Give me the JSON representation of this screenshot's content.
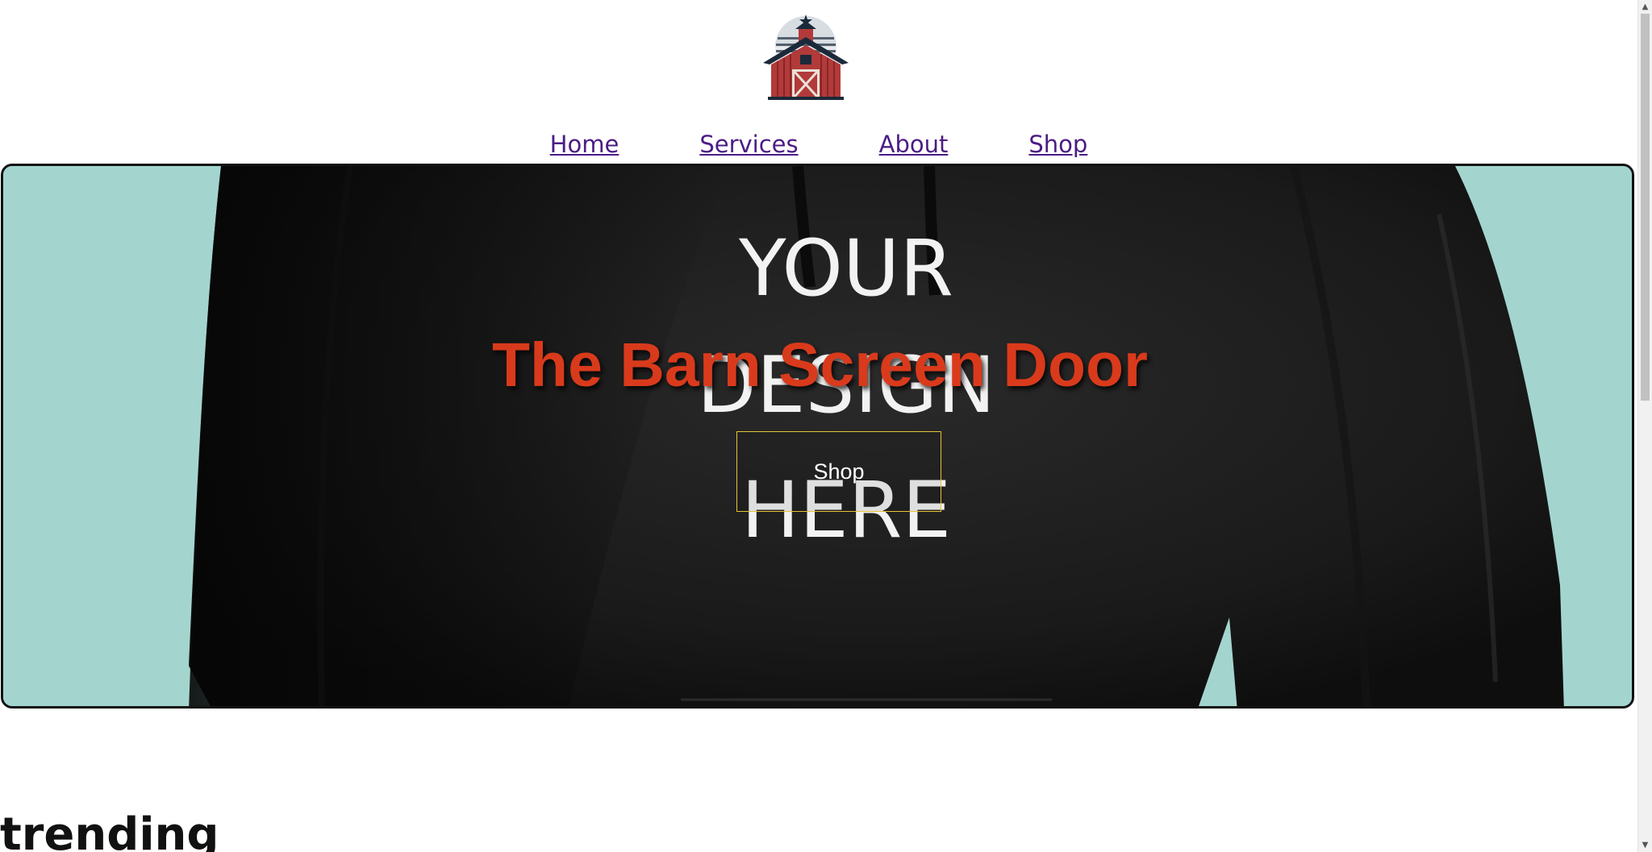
{
  "nav": {
    "items": [
      {
        "label": "Home"
      },
      {
        "label": "Services"
      },
      {
        "label": "About"
      },
      {
        "label": "Shop"
      }
    ]
  },
  "hero": {
    "title": "The Barn Screen Door",
    "shop_button": "Shop",
    "background_print": [
      "YOUR",
      "DESIGN",
      "HERE"
    ]
  },
  "sections": {
    "trending_heading": "trending"
  },
  "icons": {
    "logo": "barn-logo-icon",
    "scroll_up": "chevron-up-icon",
    "scroll_down": "chevron-down-icon"
  },
  "colors": {
    "nav_link": "#4b1c84",
    "hero_title": "#d93a1c",
    "hero_background": "#a3d5ce",
    "button_border": "#e6c534",
    "hoodie": "#1f1f1f"
  }
}
